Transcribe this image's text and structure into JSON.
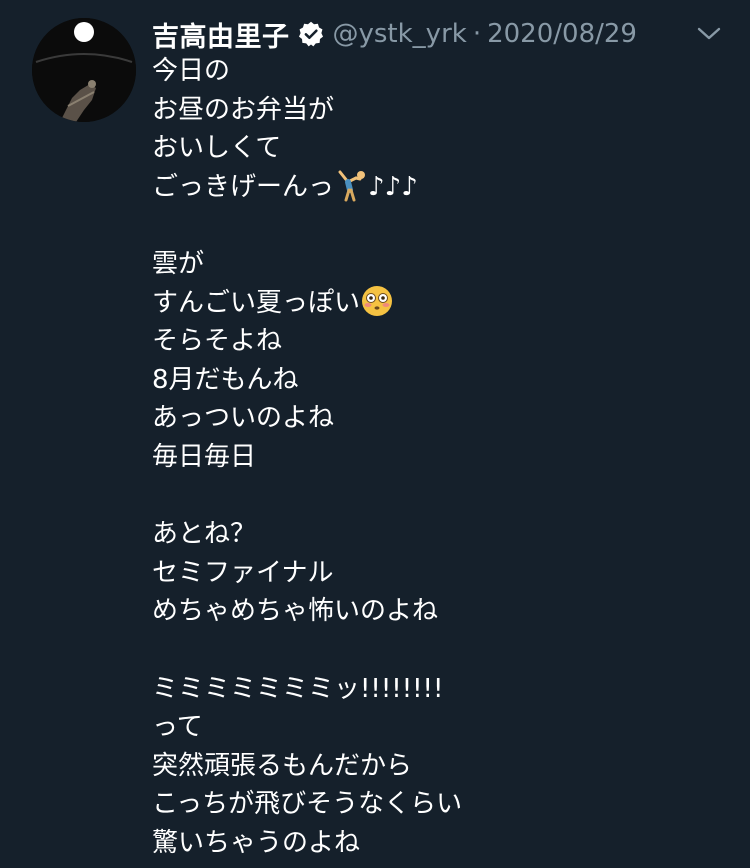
{
  "tweet": {
    "author_name": "吉高由里子",
    "handle": "@ystk_yrk",
    "separator": "·",
    "date": "2020/08/29",
    "icons": {
      "verified": "verified-badge-icon",
      "menu": "chevron-down-icon",
      "emoji_1": "cartwheel-emoji",
      "emoji_2": "flushed-face-emoji"
    },
    "lines": [
      "今日の",
      "お昼のお弁当が",
      "おいしくて",
      "ごっきげーんっ",
      "",
      "雲が",
      "すんごい夏っぽい",
      "そらそよね",
      "8月だもんね",
      "あっついのよね",
      "毎日毎日",
      "",
      "あとね？",
      "セミファイナル",
      "めちゃめちゃ怖いのよね",
      "",
      "ミミミミミミミッ!!!!!!!!",
      "って",
      "突然頑張るもんだから",
      "こっちが飛びそうなくらい",
      "驚いちゃうのよね"
    ],
    "line_suffix_3": "♪♪♪"
  },
  "colors": {
    "background": "#15202b",
    "text": "#ffffff",
    "secondary": "#8899a6"
  }
}
